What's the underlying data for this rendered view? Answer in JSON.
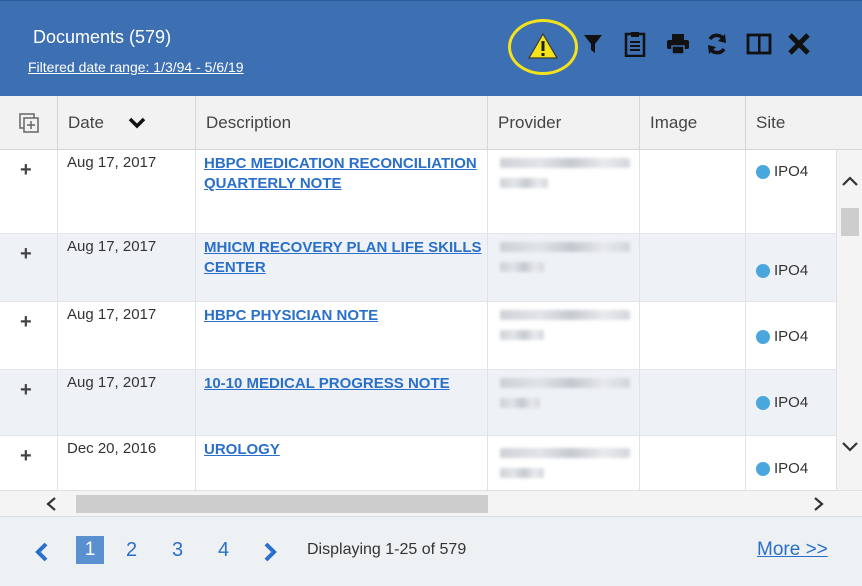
{
  "header": {
    "title": "Documents (579)",
    "filter_link": "Filtered date range: 1/3/94 - 5/6/19",
    "icons": [
      "warning-icon",
      "filter-icon",
      "clipboard-icon",
      "print-icon",
      "refresh-icon",
      "maximize-icon",
      "close-icon"
    ]
  },
  "columns": {
    "date": "Date",
    "description": "Description",
    "provider": "Provider",
    "image": "Image",
    "site": "Site"
  },
  "rows": [
    {
      "expand": "+",
      "date": "Aug 17, 2017",
      "description": "HBPC MEDICATION RECONCILIATION QUARTERLY NOTE",
      "site": "IPO4"
    },
    {
      "expand": "+",
      "date": "Aug 17, 2017",
      "description": "MHICM RECOVERY PLAN LIFE SKILLS CENTER",
      "site": "IPO4"
    },
    {
      "expand": "+",
      "date": "Aug 17, 2017",
      "description": "HBPC PHYSICIAN NOTE",
      "site": "IPO4"
    },
    {
      "expand": "+",
      "date": "Aug 17, 2017",
      "description": "10-10 MEDICAL PROGRESS NOTE",
      "site": "IPO4"
    },
    {
      "expand": "+",
      "date": "Dec 20, 2016",
      "description": "UROLOGY",
      "site": "IPO4"
    }
  ],
  "pagination": {
    "pages": [
      "1",
      "2",
      "3",
      "4"
    ],
    "active_page": "1",
    "displaying": "Displaying 1-25 of 579",
    "more": "More >>"
  },
  "colors": {
    "header_bg": "#3d6fb3",
    "link": "#2a6fc9",
    "site_dot": "#4aa7de",
    "warning": "#f4e21a"
  }
}
